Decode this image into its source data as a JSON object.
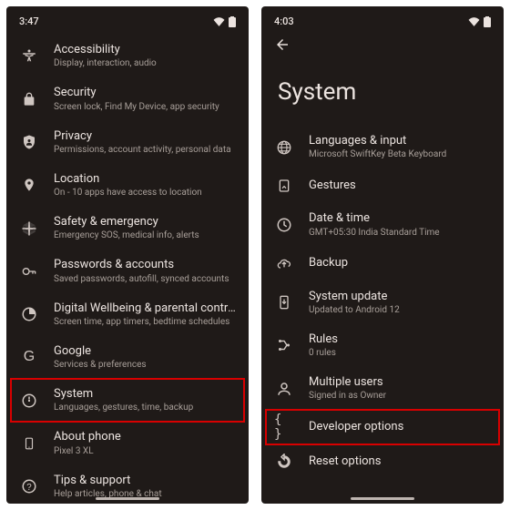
{
  "left": {
    "status_time": "3:47",
    "items": [
      {
        "icon": "accessibility",
        "title": "Accessibility",
        "sub": "Display, interaction, audio"
      },
      {
        "icon": "lock",
        "title": "Security",
        "sub": "Screen lock, Find My Device, app security"
      },
      {
        "icon": "privacy",
        "title": "Privacy",
        "sub": "Permissions, account activity, personal data"
      },
      {
        "icon": "location",
        "title": "Location",
        "sub": "On - 10 apps have access to location"
      },
      {
        "icon": "safety",
        "title": "Safety & emergency",
        "sub": "Emergency SOS, medical info, alerts"
      },
      {
        "icon": "passwords",
        "title": "Passwords & accounts",
        "sub": "Saved passwords, autofill, synced accounts"
      },
      {
        "icon": "wellbeing",
        "title": "Digital Wellbeing & parental controls",
        "sub": "Screen time, app timers, bedtime schedules"
      },
      {
        "icon": "google",
        "title": "Google",
        "sub": "Services & preferences"
      },
      {
        "icon": "system",
        "title": "System",
        "sub": "Languages, gestures, time, backup"
      },
      {
        "icon": "about",
        "title": "About phone",
        "sub": "Pixel 3 XL"
      },
      {
        "icon": "tips",
        "title": "Tips & support",
        "sub": "Help articles, phone & chat"
      }
    ],
    "highlight_index": 8
  },
  "right": {
    "status_time": "4:03",
    "page_title": "System",
    "items": [
      {
        "icon": "lang",
        "title": "Languages & input",
        "sub": "Microsoft SwiftKey Beta Keyboard"
      },
      {
        "icon": "gestures",
        "title": "Gestures",
        "sub": ""
      },
      {
        "icon": "clock",
        "title": "Date & time",
        "sub": "GMT+05:30 India Standard Time"
      },
      {
        "icon": "backup",
        "title": "Backup",
        "sub": ""
      },
      {
        "icon": "update",
        "title": "System update",
        "sub": "Updated to Android 12"
      },
      {
        "icon": "rules",
        "title": "Rules",
        "sub": "0 rules"
      },
      {
        "icon": "users",
        "title": "Multiple users",
        "sub": "Signed in as Owner"
      },
      {
        "icon": "dev",
        "title": "Developer options",
        "sub": ""
      },
      {
        "icon": "reset",
        "title": "Reset options",
        "sub": ""
      }
    ],
    "highlight_index": 7
  }
}
